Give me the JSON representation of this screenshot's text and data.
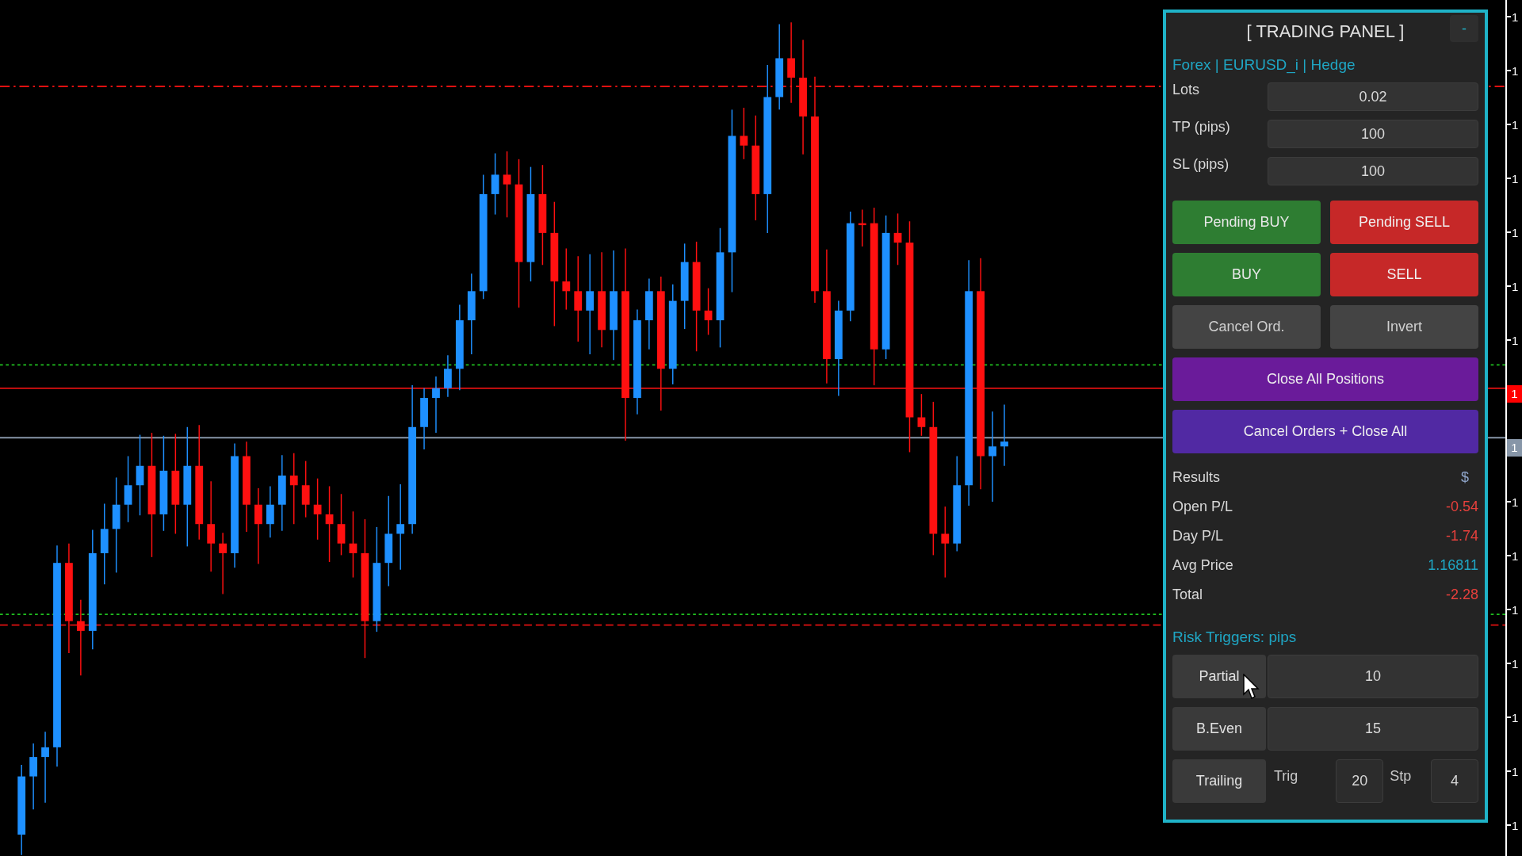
{
  "panel": {
    "title": "[ TRADING PANEL ]",
    "minimize": "-",
    "subtitle": "Forex | EURUSD_i | Hedge",
    "inputs": [
      {
        "label": "Lots",
        "value": "0.02"
      },
      {
        "label": "TP (pips)",
        "value": "100"
      },
      {
        "label": "SL (pips)",
        "value": "100"
      }
    ],
    "button_rows": [
      [
        {
          "label": "Pending BUY",
          "kind": "buy"
        },
        {
          "label": "Pending SELL",
          "kind": "sell"
        }
      ],
      [
        {
          "label": "BUY",
          "kind": "buy"
        },
        {
          "label": "SELL",
          "kind": "sell"
        }
      ],
      [
        {
          "label": "Cancel Ord.",
          "kind": "neutral"
        },
        {
          "label": "Invert",
          "kind": "neutral"
        }
      ],
      [
        {
          "label": "Close All Positions",
          "kind": "close"
        }
      ],
      [
        {
          "label": "Cancel Orders + Close All",
          "kind": "cancel_all"
        }
      ]
    ],
    "results": {
      "header": "Results",
      "currency": "$",
      "rows": [
        {
          "label": "Open P/L",
          "value": "-0.54",
          "color": "#e8403c"
        },
        {
          "label": "Day P/L",
          "value": "-1.74",
          "color": "#e8403c"
        },
        {
          "label": "Avg Price",
          "value": "1.16811",
          "color": "#1fa6c4"
        },
        {
          "label": "Total",
          "value": "-2.28",
          "color": "#e8403c"
        }
      ]
    },
    "risk": {
      "title": "Risk Triggers: pips",
      "partial": {
        "label": "Partial",
        "value": "10"
      },
      "breakeven": {
        "label": "B.Even",
        "value": "15"
      },
      "trailing": {
        "label": "Trailing",
        "trig_label": "Trig",
        "trig_value": "20",
        "step_label": "Stp",
        "step_value": "4"
      }
    }
  },
  "price_axis": {
    "rows": [
      {
        "kind": "label",
        "text": "1"
      },
      {
        "kind": "label",
        "text": "1"
      },
      {
        "kind": "label",
        "text": "1"
      },
      {
        "kind": "label",
        "text": "1"
      },
      {
        "kind": "label",
        "text": "1"
      },
      {
        "kind": "label",
        "text": "1"
      },
      {
        "kind": "label",
        "text": "1"
      },
      {
        "kind": "tag",
        "text": "1",
        "color": "#ff0000"
      },
      {
        "kind": "tag",
        "text": "1",
        "color": "#8796a8"
      },
      {
        "kind": "label",
        "text": "1"
      },
      {
        "kind": "label",
        "text": "1"
      },
      {
        "kind": "label",
        "text": "1"
      },
      {
        "kind": "label",
        "text": "1"
      },
      {
        "kind": "label",
        "text": "1"
      },
      {
        "kind": "label",
        "text": "1"
      },
      {
        "kind": "label",
        "text": "1"
      }
    ]
  }
}
